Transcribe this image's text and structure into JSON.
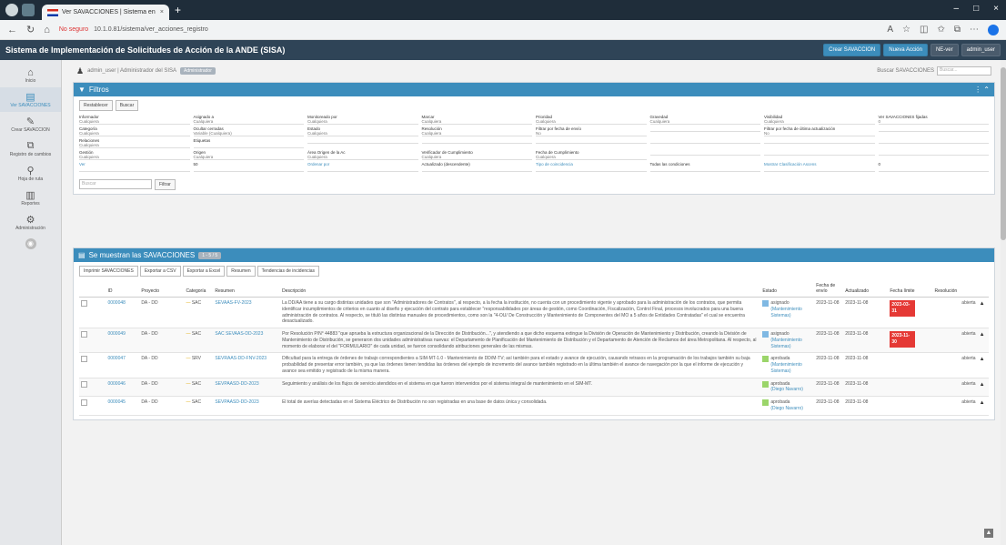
{
  "browser": {
    "tab_title": "Ver SAVACCIONES | Sistema en",
    "tab_close": "×",
    "new_tab": "+",
    "win_controls": [
      "–",
      "□",
      "×"
    ],
    "address_insecure": "No seguro",
    "address_url": "10.1.0.81/sistema/ver_acciones_registro"
  },
  "app": {
    "title": "Sistema de Implementación de Solicitudes de Acción de la ANDE (SISA)",
    "btn_create": "Crear SAVACCION",
    "btn_new": "Nueva Acción",
    "btn_version": "NE-ver",
    "btn_user": "admin_user"
  },
  "sidebar": [
    {
      "icon": "⌂",
      "label": "Inicio",
      "name": "home"
    },
    {
      "icon": "▤",
      "label": "Ver SAVACCIONES",
      "name": "ver-savacciones",
      "active": true
    },
    {
      "icon": "✎",
      "label": "Crear SAVACCION",
      "name": "crear-savaccion"
    },
    {
      "icon": "⧉",
      "label": "Registro de cambios",
      "name": "registro"
    },
    {
      "icon": "⚲",
      "label": "Hoja de ruta",
      "name": "hoja-ruta"
    },
    {
      "icon": "▥",
      "label": "Reportes",
      "name": "reportes"
    },
    {
      "icon": "⚙",
      "label": "Administración",
      "name": "administracion"
    },
    {
      "icon": "◉",
      "label": "",
      "name": "extra"
    }
  ],
  "userline": {
    "text": "admin_user | Administrador del SISA",
    "badge": "Administrador",
    "search_label": "Buscar SAVACCIONES",
    "search_placeholder": "Buscar..."
  },
  "filters": {
    "title": "Filtros",
    "btn_restablecer": "Restablecer",
    "btn_buscar": "Buscar",
    "rows": [
      [
        {
          "label": "Informador",
          "value": "Cualquiera"
        },
        {
          "label": "Asignado a",
          "value": "Cualquiera"
        },
        {
          "label": "Monitoreado por",
          "value": "Cualquiera"
        },
        {
          "label": "Marcar",
          "value": "Cualquiera"
        },
        {
          "label": "Prioridad",
          "value": "Cualquiera"
        },
        {
          "label": "Gravedad",
          "value": "Cualquiera"
        },
        {
          "label": "Visibilidad",
          "value": "Cualquiera"
        },
        {
          "label": "Ver SAVACCIONES fijadas",
          "value": "0"
        }
      ],
      [
        {
          "label": "Categoría",
          "value": "Cualquiera"
        },
        {
          "label": "Ocultar cerradas",
          "value": "Variable (Cualquiera)"
        },
        {
          "label": "Estado",
          "value": "Cualquiera"
        },
        {
          "label": "Resolución",
          "value": "Cualquiera"
        },
        {
          "label": "Filtrar por fecha de envío",
          "value": "No"
        },
        {
          "label": "",
          "value": ""
        },
        {
          "label": "Filtrar por fecha de última actualización",
          "value": "No"
        },
        {
          "label": "",
          "value": ""
        }
      ],
      [
        {
          "label": "Relaciones",
          "value": "Cualquiera"
        },
        {
          "label": "Etiquetas",
          "value": ""
        },
        {
          "label": "",
          "value": ""
        },
        {
          "label": "",
          "value": ""
        },
        {
          "label": "",
          "value": ""
        },
        {
          "label": "",
          "value": ""
        },
        {
          "label": "",
          "value": ""
        },
        {
          "label": "",
          "value": ""
        }
      ],
      [
        {
          "label": "Gestión",
          "value": "Cualquiera"
        },
        {
          "label": "Origen",
          "value": "Cualquiera"
        },
        {
          "label": "Área Origen de la Ac",
          "value": "Cualquiera"
        },
        {
          "label": "Verificador de Cumplimiento",
          "value": "Cualquiera"
        },
        {
          "label": "Fecha de Cumplimiento",
          "value": "Cualquiera"
        },
        {
          "label": "",
          "value": ""
        },
        {
          "label": "",
          "value": ""
        },
        {
          "label": "",
          "value": ""
        }
      ],
      [
        {
          "label": "Ver",
          "value": "",
          "blue": true
        },
        {
          "label": "50",
          "value": ""
        },
        {
          "label": "Ordenar por",
          "value": "",
          "blue": true
        },
        {
          "label": "Actualizado (descendente)",
          "value": ""
        },
        {
          "label": "Tipo de coincidencia",
          "value": "",
          "blue": true
        },
        {
          "label": "Todas las condiciones",
          "value": ""
        },
        {
          "label": "Mostrar Clasificación Ascens",
          "value": "",
          "blue": true
        },
        {
          "label": "0",
          "value": ""
        }
      ]
    ],
    "search_placeholder": "Buscar",
    "btn_filter": "Filtrar"
  },
  "results": {
    "title": "Se muestran las SAVACCIONES",
    "count_badge": "1 - 5 / 5",
    "toolbar": [
      "Imprimir SAVACCIONES",
      "Exportar a CSV",
      "Exportar a Excel",
      "Resumen",
      "Tendencias de incidencias"
    ],
    "columns": [
      "",
      "",
      "ID",
      "Proyecto",
      "Categoría",
      "Resumen",
      "Descripción",
      "Estado",
      "Fecha de envío",
      "Actualizado",
      "Fecha límite",
      "",
      "Resolución",
      ""
    ],
    "rows": [
      {
        "id": "0000048",
        "proyecto": "DA - DD",
        "categoria": "SAC",
        "resumen": "SEVAAS-FV-2023",
        "descripcion": "La DD/AA tiene a su cargo distintas unidades que son \"Administradores de Contratos\", al respecto, a la fecha la institución, no cuenta con un procedimiento vigente y aprobado para la administración de los contratos, que permita identificar incumplimientos de criterios en cuanto al diseño y ejecución del contrato para establecer \"responsabilidades por áreas de gestión, como Coordinación, Fiscalización, Control Final, procesos involucrados para una buena administración de contratos. Al respecto, se tituló las distintas manuales de procedimientos, como son la \"4-OU/ De Construcción y Mantenimiento de Componentes del MO a 5 años de Entidades Contratadas\" el cual se encuentra desactualizado.",
        "estado": "asignado",
        "estado_sub": "(Mantenimiento Sistemas)",
        "estado_color": "blue",
        "fecha_envio": "2023-11-08",
        "actualizado": "2023-11-08",
        "fecha_limite": "2023-03-31",
        "resolucion": "abierta"
      },
      {
        "id": "0000049",
        "proyecto": "DA - DD",
        "categoria": "SAC",
        "resumen": "SAC SEVAAS-DD-2023",
        "descripcion": "Por Resolución P/N° 44883 \"que aprueba la estructura organizacional de la Dirección de Distribución...\", y atendiendo a que dicho esquema extingue la División de Operación de Mantenimiento y Distribución, creando la División de Mantenimiento de Distribución, se generaron dos unidades administrativas nuevas: el Departamento de Planificación del Mantenimiento de Distribución y el Departamento de Atención de Reclamos del área Metropolitana. Al respecto, al momento de elaborar el del \"FORMULARIO\" de cada unidad, se fueron consolidando atribuciones generales de las mismas.",
        "estado": "asignado",
        "estado_sub": "(Mantenimiento Sistemas)",
        "estado_color": "blue",
        "fecha_envio": "2023-11-08",
        "actualizado": "2023-11-08",
        "fecha_limite": "2023-11-30",
        "resolucion": "abierta"
      },
      {
        "id": "0000047",
        "proyecto": "DA - DD",
        "categoria": "SRV",
        "resumen": "SEVRAAS-DD-FNV-2023",
        "descripcion": "Dificultad para la entrega de órdenes de trabajo correspondientes a SIM-MT-1.0 - Mantenimiento de DD/M-TV; así también para el estado y avance de ejecución, causando retrasos en la programación de los trabajos también su baja probabilidad de presentar error también, ya que las órdenes tienen tendidas las órdenes del ejemplo de incremento del avance también registrado en la última también el avance de navegación por la que el informe de ejecución y avance sea emitido y registrado de la misma manera.",
        "estado": "aprobada",
        "estado_sub": "(Mantenimiento Sistemas)",
        "estado_color": "green",
        "fecha_envio": "2023-11-08",
        "actualizado": "2023-11-08",
        "fecha_limite": "",
        "resolucion": "abierta"
      },
      {
        "id": "0000046",
        "proyecto": "DA - DD",
        "categoria": "SAC",
        "resumen": "SEVPAASD-DD-2023",
        "descripcion": "Seguimiento y análisis de los flujos de servicio atendidos en el sistema en que fueron intervenidos por el sistema integral de mantenimiento en el SIM-MT.",
        "estado": "aprobada",
        "estado_sub": "(Diego Navarro)",
        "estado_color": "green",
        "fecha_envio": "2023-11-08",
        "actualizado": "2023-11-08",
        "fecha_limite": "",
        "resolucion": "abierta"
      },
      {
        "id": "0000045",
        "proyecto": "DA - DD",
        "categoria": "SAC",
        "resumen": "SEVPAASD-DD-2023",
        "descripcion": "El total de averías detectadas en el Sistema Eléctrico de Distribución no son registradas en una base de datos única y consolidada.",
        "estado": "aprobada",
        "estado_sub": "(Diego Navarro)",
        "estado_color": "green",
        "fecha_envio": "2023-11-08",
        "actualizado": "2023-11-08",
        "fecha_limite": "",
        "resolucion": "abierta"
      }
    ]
  },
  "colors": {
    "primary": "#3c8dbc",
    "appbar": "#2f4457",
    "overdue": "#e53935",
    "assigned": "#7fb8e3",
    "approved": "#9bd56a"
  }
}
